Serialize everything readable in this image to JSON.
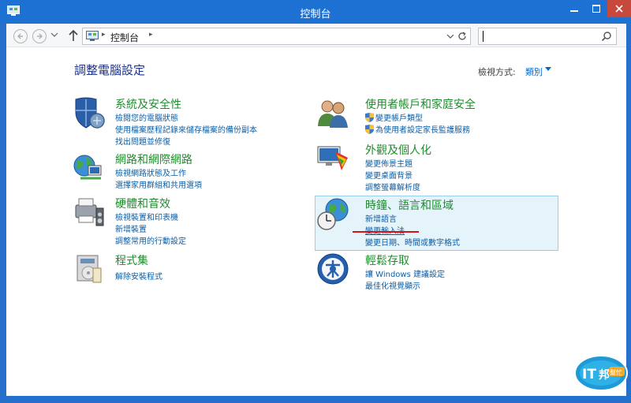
{
  "window": {
    "title": "控制台",
    "app_icon": "control-panel-icon",
    "controls": [
      "minimize-icon",
      "maximize-icon",
      "close-icon"
    ]
  },
  "navigation": {
    "back_icon": "back-arrow-icon",
    "forward_icon": "forward-arrow-icon",
    "up_icon": "up-arrow-icon",
    "address": {
      "icon": "control-panel-icon",
      "separator": "▸",
      "location": "控制台"
    },
    "refresh_icon": "refresh-icon",
    "search": {
      "value": "",
      "icon": "search-icon"
    }
  },
  "main": {
    "title": "調整電腦設定",
    "view_by": {
      "label": "檢視方式:",
      "value": "類別"
    },
    "categories_left": [
      {
        "icon": "system-security-icon",
        "title": "系統及安全性",
        "links": [
          "檢閱您的電腦狀態",
          "使用檔案歷程記錄來儲存檔案的備份副本",
          "找出問題並修復"
        ]
      },
      {
        "icon": "network-internet-icon",
        "title": "網路和網際網路",
        "links": [
          "檢視網路狀態及工作",
          "選擇家用群組和共用選項"
        ]
      },
      {
        "icon": "hardware-sound-icon",
        "title": "硬體和音效",
        "links": [
          "檢視裝置和印表機",
          "新增裝置",
          "調整常用的行動設定"
        ]
      },
      {
        "icon": "programs-icon",
        "title": "程式集",
        "links": [
          "解除安裝程式"
        ]
      }
    ],
    "categories_right": [
      {
        "icon": "user-accounts-icon",
        "title": "使用者帳戶和家庭安全",
        "links": [
          "變更帳戶類型",
          "為使用者設定家長監護服務"
        ]
      },
      {
        "icon": "appearance-personalization-icon",
        "title": "外觀及個人化",
        "links": [
          "變更佈景主題",
          "變更桌面背景",
          "調整螢幕解析度"
        ]
      },
      {
        "icon": "clock-language-region-icon",
        "title": "時鐘、語言和區域",
        "links": [
          "新增語言",
          "變更輸入法",
          "變更日期、時間或數字格式"
        ]
      },
      {
        "icon": "ease-of-access-icon",
        "title": "輕鬆存取",
        "links": [
          "讓 Windows 建議設定",
          "最佳化視覺顯示"
        ]
      }
    ]
  },
  "colors": {
    "titlebar": "#1d71d3",
    "close_button": "#c7493b",
    "category_title": "#1e8c2c",
    "link": "#0b5ea6",
    "page_title": "#1e3287",
    "highlight": "#e5f3fb",
    "annotation_underline": "#d8121a"
  },
  "watermark": {
    "icon": "ithome-logo",
    "text": "IT邦幫忙"
  }
}
